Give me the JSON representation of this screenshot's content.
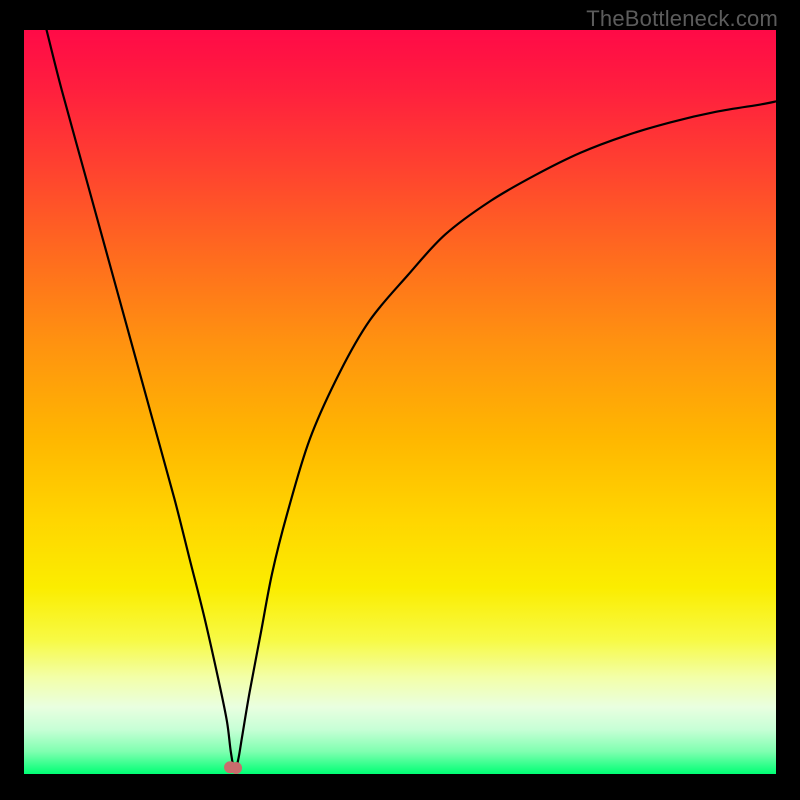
{
  "watermark": "TheBottleneck.com",
  "chart_data": {
    "type": "line",
    "title": "",
    "xlabel": "",
    "ylabel": "",
    "x_range": [
      0,
      100
    ],
    "y_range": [
      0,
      100
    ],
    "series": [
      {
        "name": "bottleneck-curve",
        "x": [
          3,
          5,
          8,
          11,
          14,
          17,
          20,
          22,
          24,
          26,
          27,
          27.5,
          28,
          28.5,
          29,
          30,
          31.5,
          33,
          35,
          38,
          42,
          46,
          51,
          56,
          62,
          68,
          74,
          80,
          86,
          92,
          98,
          100
        ],
        "y": [
          100,
          92,
          81,
          70,
          59,
          48,
          37,
          29,
          21,
          12,
          7,
          3,
          0.5,
          2,
          5,
          11,
          19,
          27,
          35,
          45,
          54,
          61,
          67,
          72.5,
          77,
          80.5,
          83.5,
          85.8,
          87.6,
          89,
          90,
          90.4
        ]
      }
    ],
    "annotations": [
      {
        "name": "optimal-point",
        "x": 27.4,
        "y": 0.9
      },
      {
        "name": "optimal-point",
        "x": 28.2,
        "y": 0.8
      }
    ],
    "background": "red-green-gradient"
  }
}
